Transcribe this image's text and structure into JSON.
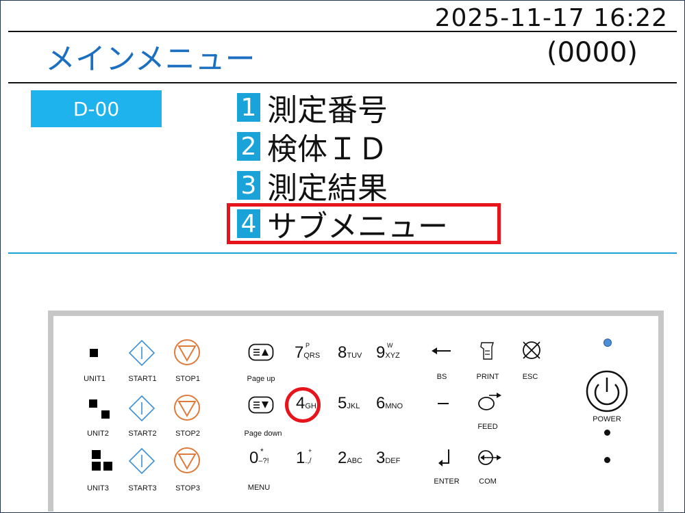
{
  "header": {
    "datetime": "2025-11-17 16:22",
    "title": "メインメニュー",
    "code": "(0000)"
  },
  "device_id": "D-00",
  "menu": [
    {
      "num": "1",
      "label": "測定番号"
    },
    {
      "num": "2",
      "label": "検体ＩＤ"
    },
    {
      "num": "3",
      "label": "測定結果"
    },
    {
      "num": "4",
      "label": "サブメニュー"
    }
  ],
  "keypad": {
    "units": [
      "UNIT1",
      "UNIT2",
      "UNIT3"
    ],
    "starts": [
      "START1",
      "START2",
      "START3"
    ],
    "stops": [
      "STOP1",
      "STOP2",
      "STOP3"
    ],
    "page_up": "Page up",
    "page_down": "Page down",
    "menu": "MENU",
    "keys": {
      "k7": {
        "digit": "7",
        "sup": "P",
        "sub": "QRS"
      },
      "k8": {
        "digit": "8",
        "sub": "TUV"
      },
      "k9": {
        "digit": "9",
        "sup": "W",
        "sub": "XYZ"
      },
      "k4": {
        "digit": "4",
        "sub": "GH"
      },
      "k5": {
        "digit": "5",
        "sub": "JKL"
      },
      "k6": {
        "digit": "6",
        "sub": "MNO"
      },
      "k0": {
        "digit": "0",
        "sup": "*",
        "sub": "–?!"
      },
      "k1": {
        "digit": "1",
        "sup": "+",
        "sub": ".,/"
      },
      "k2": {
        "digit": "2",
        "sub": "ABC"
      },
      "k3": {
        "digit": "3",
        "sub": "DEF"
      }
    },
    "bs": "BS",
    "print": "PRINT",
    "esc": "ESC",
    "feed": "FEED",
    "enter": "ENTER",
    "com": "COM",
    "power": "POWER"
  },
  "colors": {
    "accent": "#1aa3d9",
    "title": "#1a6fc0",
    "highlight": "#e8141b",
    "start": "#3a8fd6",
    "stop": "#e07a3a"
  }
}
